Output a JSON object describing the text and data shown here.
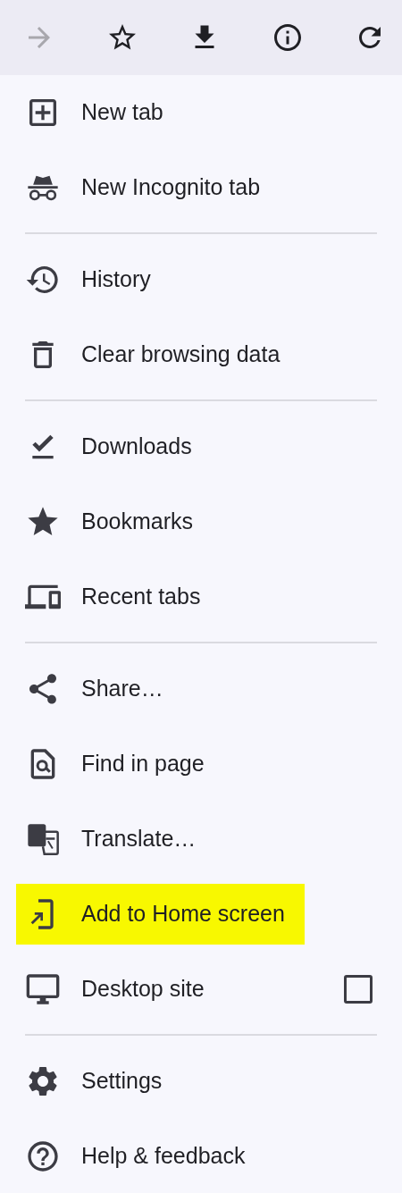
{
  "toolbar": [
    {
      "kind": "forward",
      "disabled": true
    },
    {
      "kind": "star",
      "disabled": false
    },
    {
      "kind": "download",
      "disabled": false
    },
    {
      "kind": "info",
      "disabled": false
    },
    {
      "kind": "refresh",
      "disabled": false
    }
  ],
  "sections": [
    {
      "items": [
        {
          "kind": "new-tab",
          "label": "New tab",
          "highlighted": false
        },
        {
          "kind": "incognito",
          "label": "New Incognito tab",
          "highlighted": false
        }
      ]
    },
    {
      "items": [
        {
          "kind": "history",
          "label": "History",
          "highlighted": false
        },
        {
          "kind": "trash",
          "label": "Clear browsing data",
          "highlighted": false
        }
      ]
    },
    {
      "items": [
        {
          "kind": "downloads",
          "label": "Downloads",
          "highlighted": false
        },
        {
          "kind": "bookmarks",
          "label": "Bookmarks",
          "highlighted": false
        },
        {
          "kind": "devices",
          "label": "Recent tabs",
          "highlighted": false
        }
      ]
    },
    {
      "items": [
        {
          "kind": "share",
          "label": "Share…",
          "highlighted": false
        },
        {
          "kind": "find",
          "label": "Find in page",
          "highlighted": false
        },
        {
          "kind": "translate",
          "label": "Translate…",
          "highlighted": false
        },
        {
          "kind": "add-home",
          "label": "Add to Home screen",
          "highlighted": true
        },
        {
          "kind": "desktop",
          "label": "Desktop site",
          "highlighted": false,
          "checked": false
        }
      ]
    },
    {
      "items": [
        {
          "kind": "settings",
          "label": "Settings",
          "highlighted": false
        },
        {
          "kind": "help",
          "label": "Help & feedback",
          "highlighted": false
        }
      ]
    }
  ]
}
